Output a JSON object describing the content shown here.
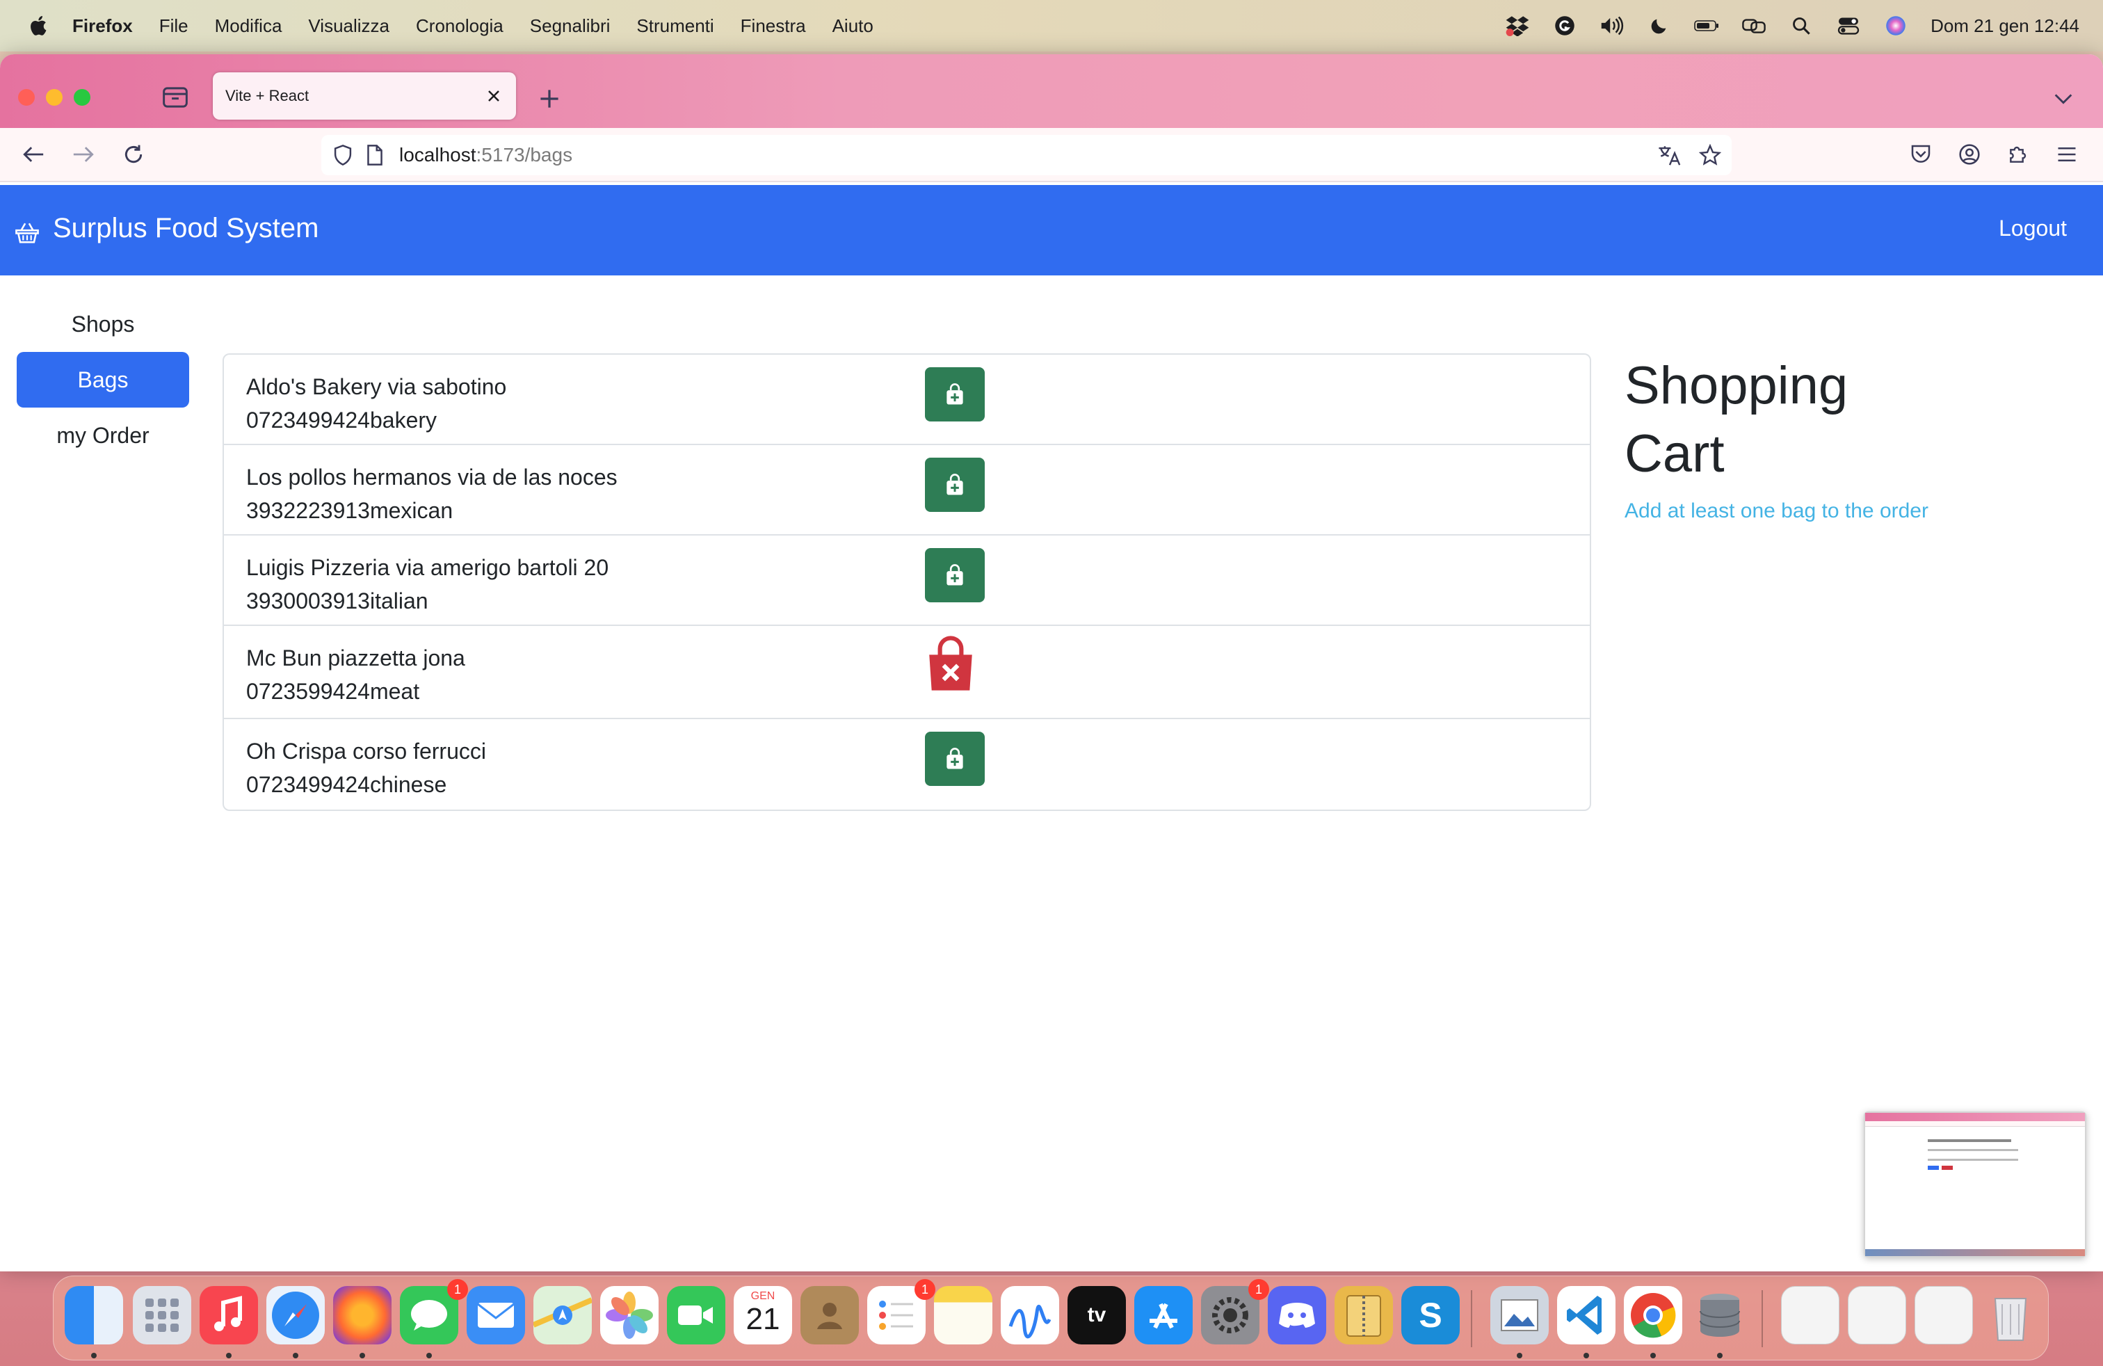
{
  "menubar": {
    "app_name": "Firefox",
    "items": [
      "File",
      "Modifica",
      "Visualizza",
      "Cronologia",
      "Segnalibri",
      "Strumenti",
      "Finestra",
      "Aiuto"
    ],
    "clock": "Dom 21 gen  12:44"
  },
  "browser": {
    "tab_title": "Vite + React",
    "url_host": "localhost",
    "url_path": ":5173/bags"
  },
  "app": {
    "brand": "Surplus Food System",
    "logout_label": "Logout",
    "nav": {
      "shops": "Shops",
      "bags": "Bags",
      "my_order": "my Order"
    },
    "bags": [
      {
        "line1": "Aldo's Bakery via sabotino",
        "line2": "0723499424bakery",
        "available": true
      },
      {
        "line1": "Los pollos hermanos via de las noces",
        "line2": "3932223913mexican",
        "available": true
      },
      {
        "line1": "Luigis Pizzeria via amerigo bartoli 20",
        "line2": "3930003913italian",
        "available": true
      },
      {
        "line1": "Mc Bun piazzetta jona",
        "line2": "0723599424meat",
        "available": false
      },
      {
        "line1": "Oh Crispa corso ferrucci",
        "line2": "0723499424chinese",
        "available": true
      }
    ],
    "cart": {
      "title_line1": "Shopping",
      "title_line2": "Cart",
      "hint": "Add at least one bag to the order"
    }
  },
  "dock": {
    "calendar_month": "GEN",
    "calendar_day": "21",
    "badges": {
      "messages": "1",
      "reminders": "1",
      "settings": "1"
    }
  },
  "colors": {
    "primary": "#306cf0",
    "success": "#2e7d55",
    "danger": "#d0353f",
    "info": "#44b3e4"
  }
}
